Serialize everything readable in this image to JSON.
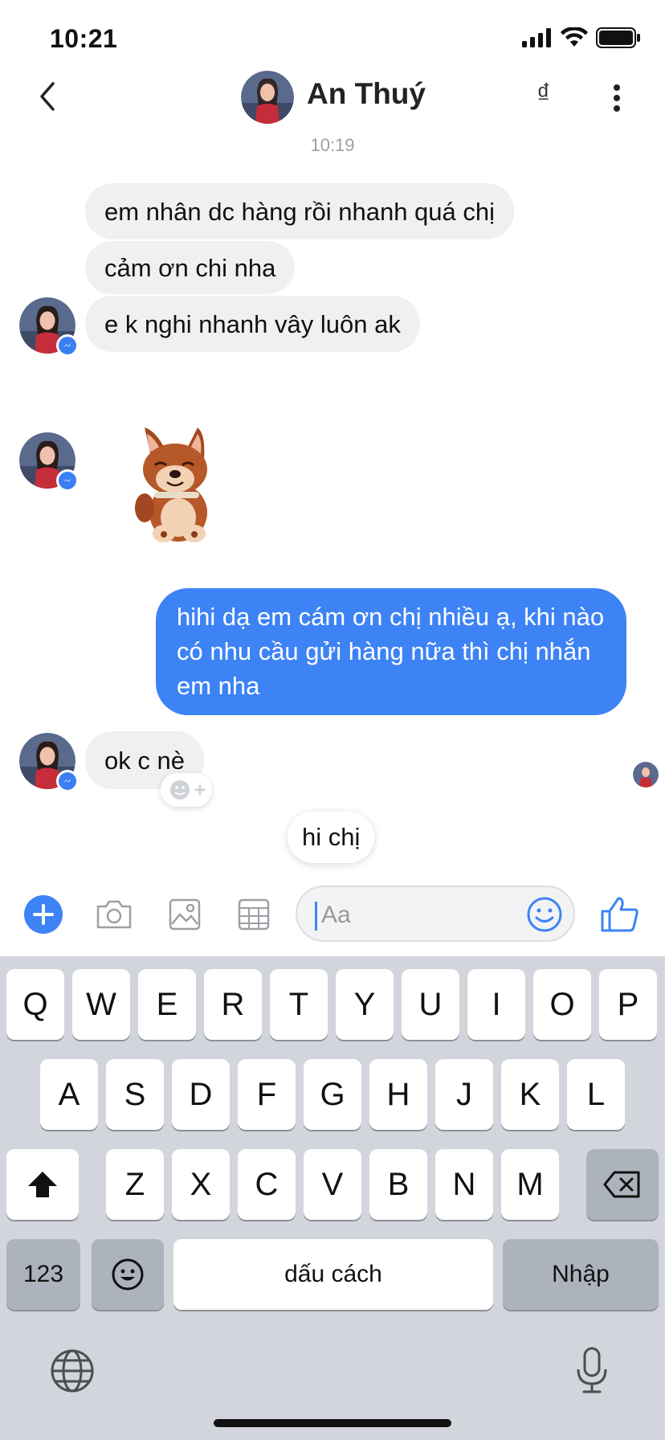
{
  "status_bar": {
    "time": "10:21"
  },
  "header": {
    "contact_name": "An Thuý",
    "currency_symbol": "₫"
  },
  "conversation": {
    "timestamp": "10:19",
    "incoming_group_1": [
      "em nhân dc hàng rồi nhanh quá chị",
      "cảm ơn chi nha",
      "e k nghi nhanh vây luôn ak"
    ],
    "outgoing_message": "hihi dạ em cám ơn chị nhiều ạ, khi nào có nhu cầu gửi hàng nữa thì chị nhắn em nha",
    "incoming_last": "ok c nè",
    "quick_reply": "hi chị"
  },
  "composer": {
    "placeholder": "Aa"
  },
  "keyboard": {
    "row1": [
      "Q",
      "W",
      "E",
      "R",
      "T",
      "Y",
      "U",
      "I",
      "O",
      "P"
    ],
    "row2": [
      "A",
      "S",
      "D",
      "F",
      "G",
      "H",
      "J",
      "K",
      "L"
    ],
    "row3": [
      "Z",
      "X",
      "C",
      "V",
      "B",
      "N",
      "M"
    ],
    "numbers_key": "123",
    "space_key": "dấu cách",
    "return_key": "Nhập"
  },
  "colors": {
    "accent": "#3d83f5",
    "incoming_bubble": "#f0f0f0",
    "keyboard_bg": "#d2d5db"
  }
}
